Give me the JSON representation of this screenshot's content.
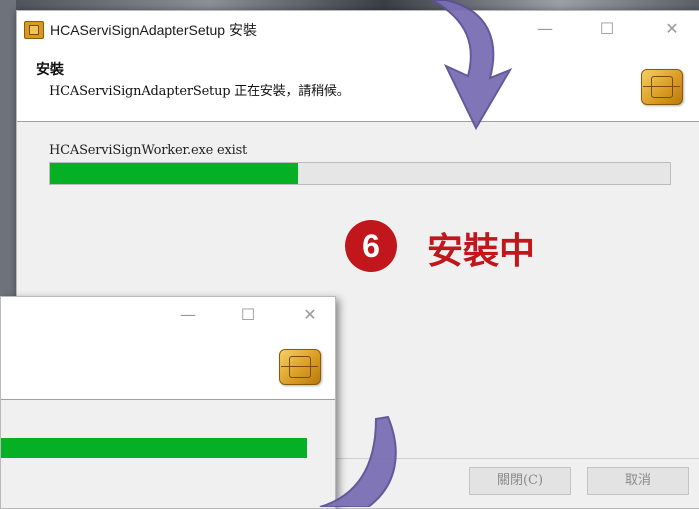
{
  "main_window": {
    "title": "HCAServiSignAdapterSetup 安裝",
    "minimize": "—",
    "maximize": "☐",
    "close": "✕",
    "header_title": "安裝",
    "header_subtitle": "HCAServiSignAdapterSetup 正在安裝，請稍候。",
    "status": "HCAServiSignWorker.exe exist",
    "progress_fraction": 0.4,
    "close_button": "關閉(C)",
    "cancel_button": "取消"
  },
  "step_badge": {
    "number": "6",
    "label": "安裝中"
  },
  "second_window": {
    "minimize": "—",
    "maximize": "☐",
    "close": "✕",
    "progress_fraction": 1.0
  },
  "colors": {
    "progress_green": "#06b025",
    "step_red": "#c0161c",
    "arrow_purple": "#7a6fb4"
  }
}
